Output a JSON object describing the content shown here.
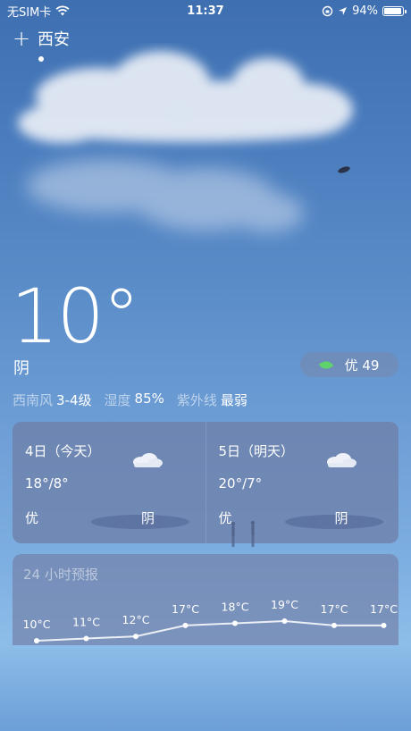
{
  "status_bar": {
    "carrier": "无SIM卡",
    "time": "11:37",
    "battery": "94%",
    "battery_level": 0.94,
    "icons": [
      "wifi-icon",
      "orientation-lock-icon",
      "location-arrow-icon",
      "battery-icon"
    ]
  },
  "header": {
    "add_symbol": "+",
    "city": "西安"
  },
  "current": {
    "temperature": "10°",
    "condition": "阴",
    "aqi_label": "优 49",
    "wind_label": "西南风",
    "wind_value": "3-4级",
    "humidity_label": "湿度",
    "humidity_value": "85%",
    "uv_label": "紫外线",
    "uv_value": "最弱"
  },
  "forecast": [
    {
      "date": "4日（今天）",
      "range": "18°/8°",
      "aqi": "优",
      "condition": "阴",
      "icon": "cloud-icon"
    },
    {
      "date": "5日（明天）",
      "range": "20°/7°",
      "aqi": "优",
      "condition": "阴",
      "icon": "cloud-icon"
    }
  ],
  "hourly": {
    "title": "24 小时预报",
    "temps": [
      "10°C",
      "11°C",
      "12°C",
      "17°C",
      "18°C",
      "19°C",
      "17°C",
      "17°C"
    ],
    "values": [
      10,
      11,
      12,
      17,
      18,
      19,
      17,
      17
    ]
  },
  "colors": {
    "leaf": "#5fd36b",
    "card": "#6e7da5"
  }
}
